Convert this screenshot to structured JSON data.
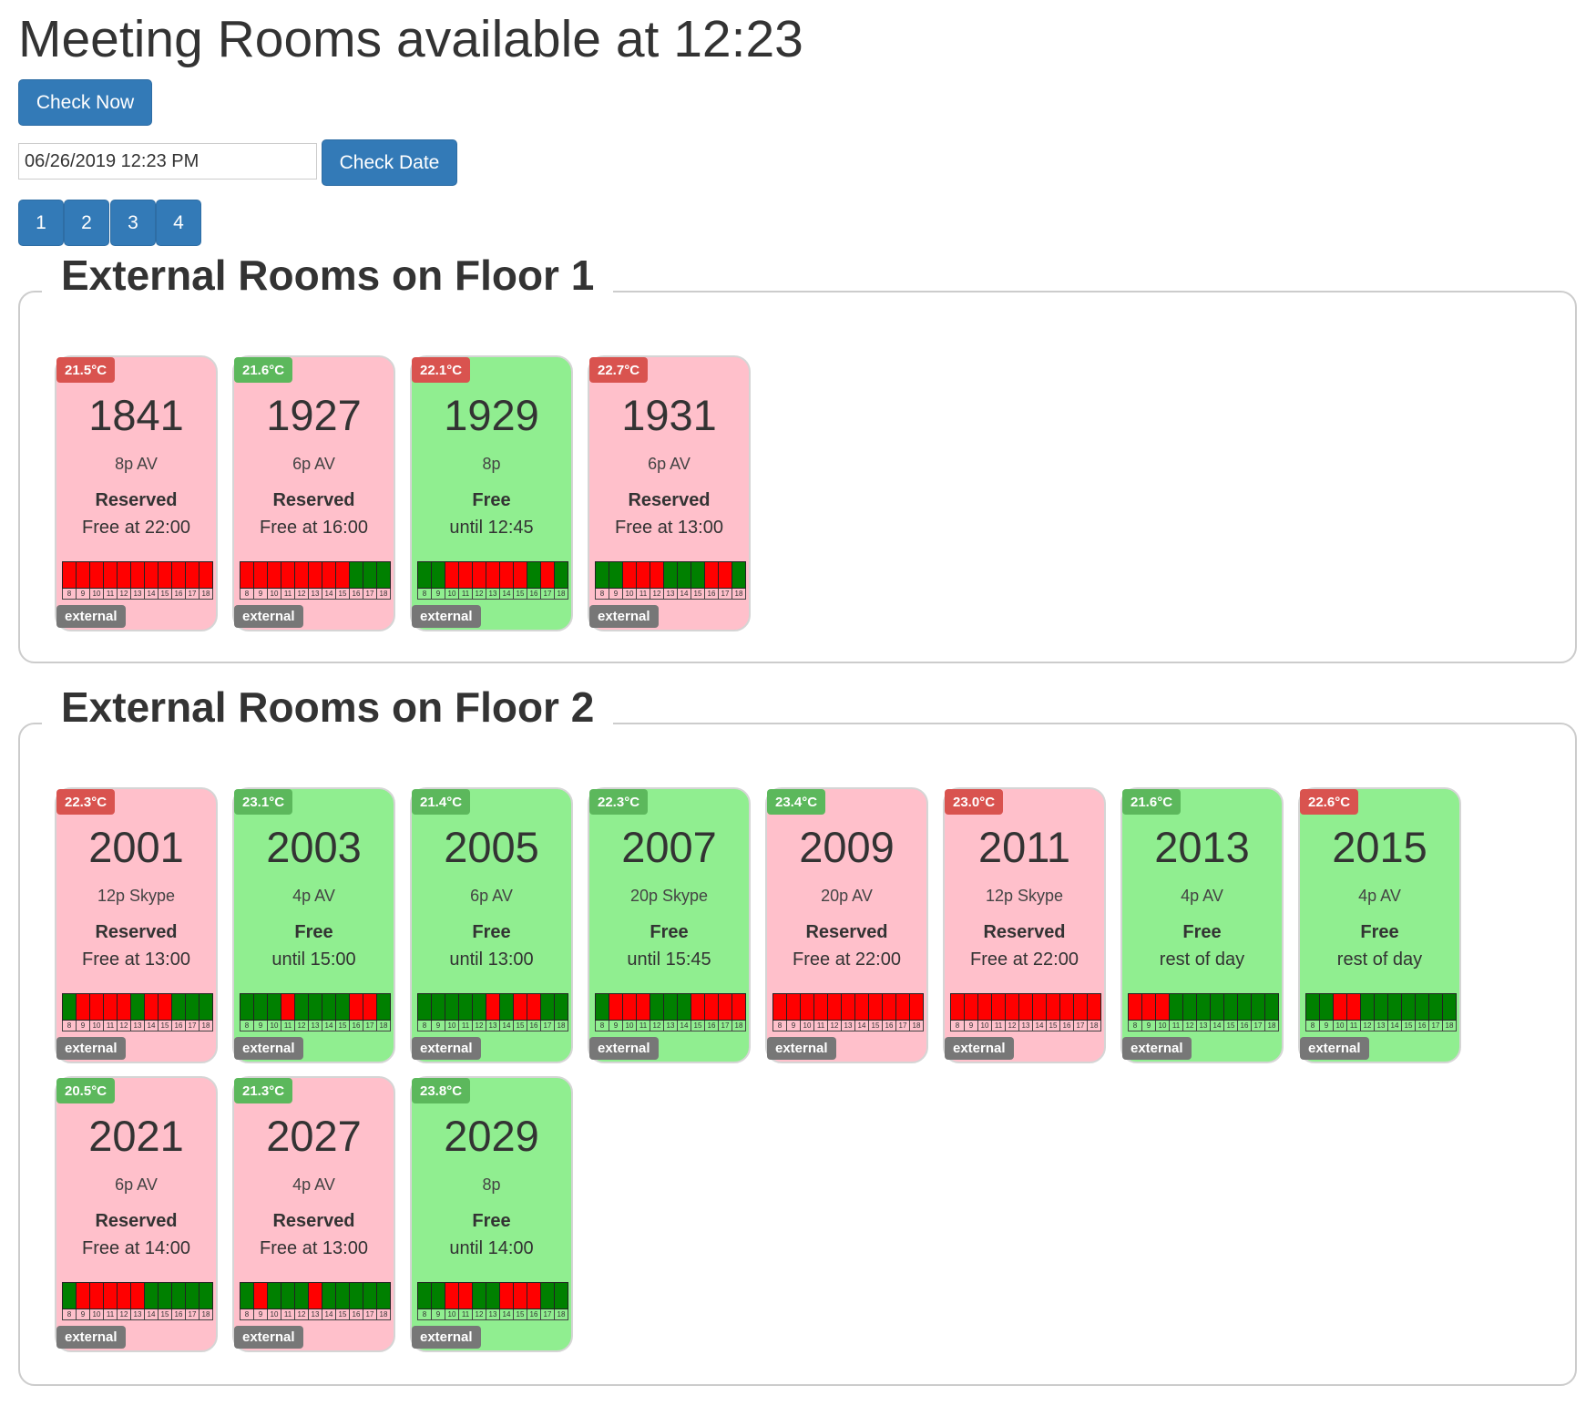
{
  "title": "Meeting Rooms available at 12:23",
  "check_now_label": "Check Now",
  "date_value": "06/26/2019 12:23 PM",
  "check_date_label": "Check Date",
  "pages": [
    "1",
    "2",
    "3",
    "4"
  ],
  "hours": [
    "8",
    "9",
    "10",
    "11",
    "12",
    "13",
    "14",
    "15",
    "16",
    "17",
    "18"
  ],
  "colors": {
    "reserved_bg": "#ffc0cb",
    "free_bg": "#90ee90",
    "slot_busy": "#ff0000",
    "slot_free": "#008000",
    "temp_hot": "#d9534f",
    "temp_ok": "#5cb85c",
    "button": "#337ab7",
    "tag": "#777777"
  },
  "floors": [
    {
      "title": "External Rooms on Floor 1",
      "rooms": [
        {
          "temp": "21.5°C",
          "temp_state": "hot",
          "number": "1841",
          "capacity": "8p AV",
          "status": "Reserved",
          "until": "Free at 22:00",
          "free": false,
          "slots": "rrrrrrrrrrr",
          "tag": "external"
        },
        {
          "temp": "21.6°C",
          "temp_state": "ok",
          "number": "1927",
          "capacity": "6p AV",
          "status": "Reserved",
          "until": "Free at 16:00",
          "free": false,
          "slots": "rrrrrrrrggg",
          "tag": "external"
        },
        {
          "temp": "22.1°C",
          "temp_state": "hot",
          "number": "1929",
          "capacity": "8p",
          "status": "Free",
          "until": "until 12:45",
          "free": true,
          "slots": "ggrrrrrrgrg",
          "tag": "external"
        },
        {
          "temp": "22.7°C",
          "temp_state": "hot",
          "number": "1931",
          "capacity": "6p AV",
          "status": "Reserved",
          "until": "Free at 13:00",
          "free": false,
          "slots": "ggrrrgggrrg",
          "tag": "external"
        }
      ]
    },
    {
      "title": "External Rooms on Floor 2",
      "rooms": [
        {
          "temp": "22.3°C",
          "temp_state": "hot",
          "number": "2001",
          "capacity": "12p Skype",
          "status": "Reserved",
          "until": "Free at 13:00",
          "free": false,
          "slots": "grrrrgrrggg",
          "tag": "external"
        },
        {
          "temp": "23.1°C",
          "temp_state": "ok",
          "number": "2003",
          "capacity": "4p AV",
          "status": "Free",
          "until": "until 15:00",
          "free": true,
          "slots": "gggrggggrrg",
          "tag": "external"
        },
        {
          "temp": "21.4°C",
          "temp_state": "ok",
          "number": "2005",
          "capacity": "6p AV",
          "status": "Free",
          "until": "until 13:00",
          "free": true,
          "slots": "gggggrgrrgg",
          "tag": "external"
        },
        {
          "temp": "22.3°C",
          "temp_state": "ok",
          "number": "2007",
          "capacity": "20p Skype",
          "status": "Free",
          "until": "until 15:45",
          "free": true,
          "slots": "grrrgggrrrr",
          "tag": "external"
        },
        {
          "temp": "23.4°C",
          "temp_state": "ok",
          "number": "2009",
          "capacity": "20p AV",
          "status": "Reserved",
          "until": "Free at 22:00",
          "free": false,
          "slots": "rrrrrrrrrrr",
          "tag": "external"
        },
        {
          "temp": "23.0°C",
          "temp_state": "hot",
          "number": "2011",
          "capacity": "12p Skype",
          "status": "Reserved",
          "until": "Free at 22:00",
          "free": false,
          "slots": "rrrrrrrrrrr",
          "tag": "external"
        },
        {
          "temp": "21.6°C",
          "temp_state": "ok",
          "number": "2013",
          "capacity": "4p AV",
          "status": "Free",
          "until": "rest of day",
          "free": true,
          "slots": "rrrgggggggg",
          "tag": "external"
        },
        {
          "temp": "22.6°C",
          "temp_state": "hot",
          "number": "2015",
          "capacity": "4p AV",
          "status": "Free",
          "until": "rest of day",
          "free": true,
          "slots": "ggrrggggggg",
          "tag": "external"
        },
        {
          "temp": "20.5°C",
          "temp_state": "ok",
          "number": "2021",
          "capacity": "6p AV",
          "status": "Reserved",
          "until": "Free at 14:00",
          "free": false,
          "slots": "grrrrrggggg",
          "tag": "external"
        },
        {
          "temp": "21.3°C",
          "temp_state": "ok",
          "number": "2027",
          "capacity": "4p AV",
          "status": "Reserved",
          "until": "Free at 13:00",
          "free": false,
          "slots": "grgggrggggg",
          "tag": "external"
        },
        {
          "temp": "23.8°C",
          "temp_state": "ok",
          "number": "2029",
          "capacity": "8p",
          "status": "Free",
          "until": "until 14:00",
          "free": true,
          "slots": "ggrrggrrrgg",
          "tag": "external"
        }
      ]
    }
  ]
}
